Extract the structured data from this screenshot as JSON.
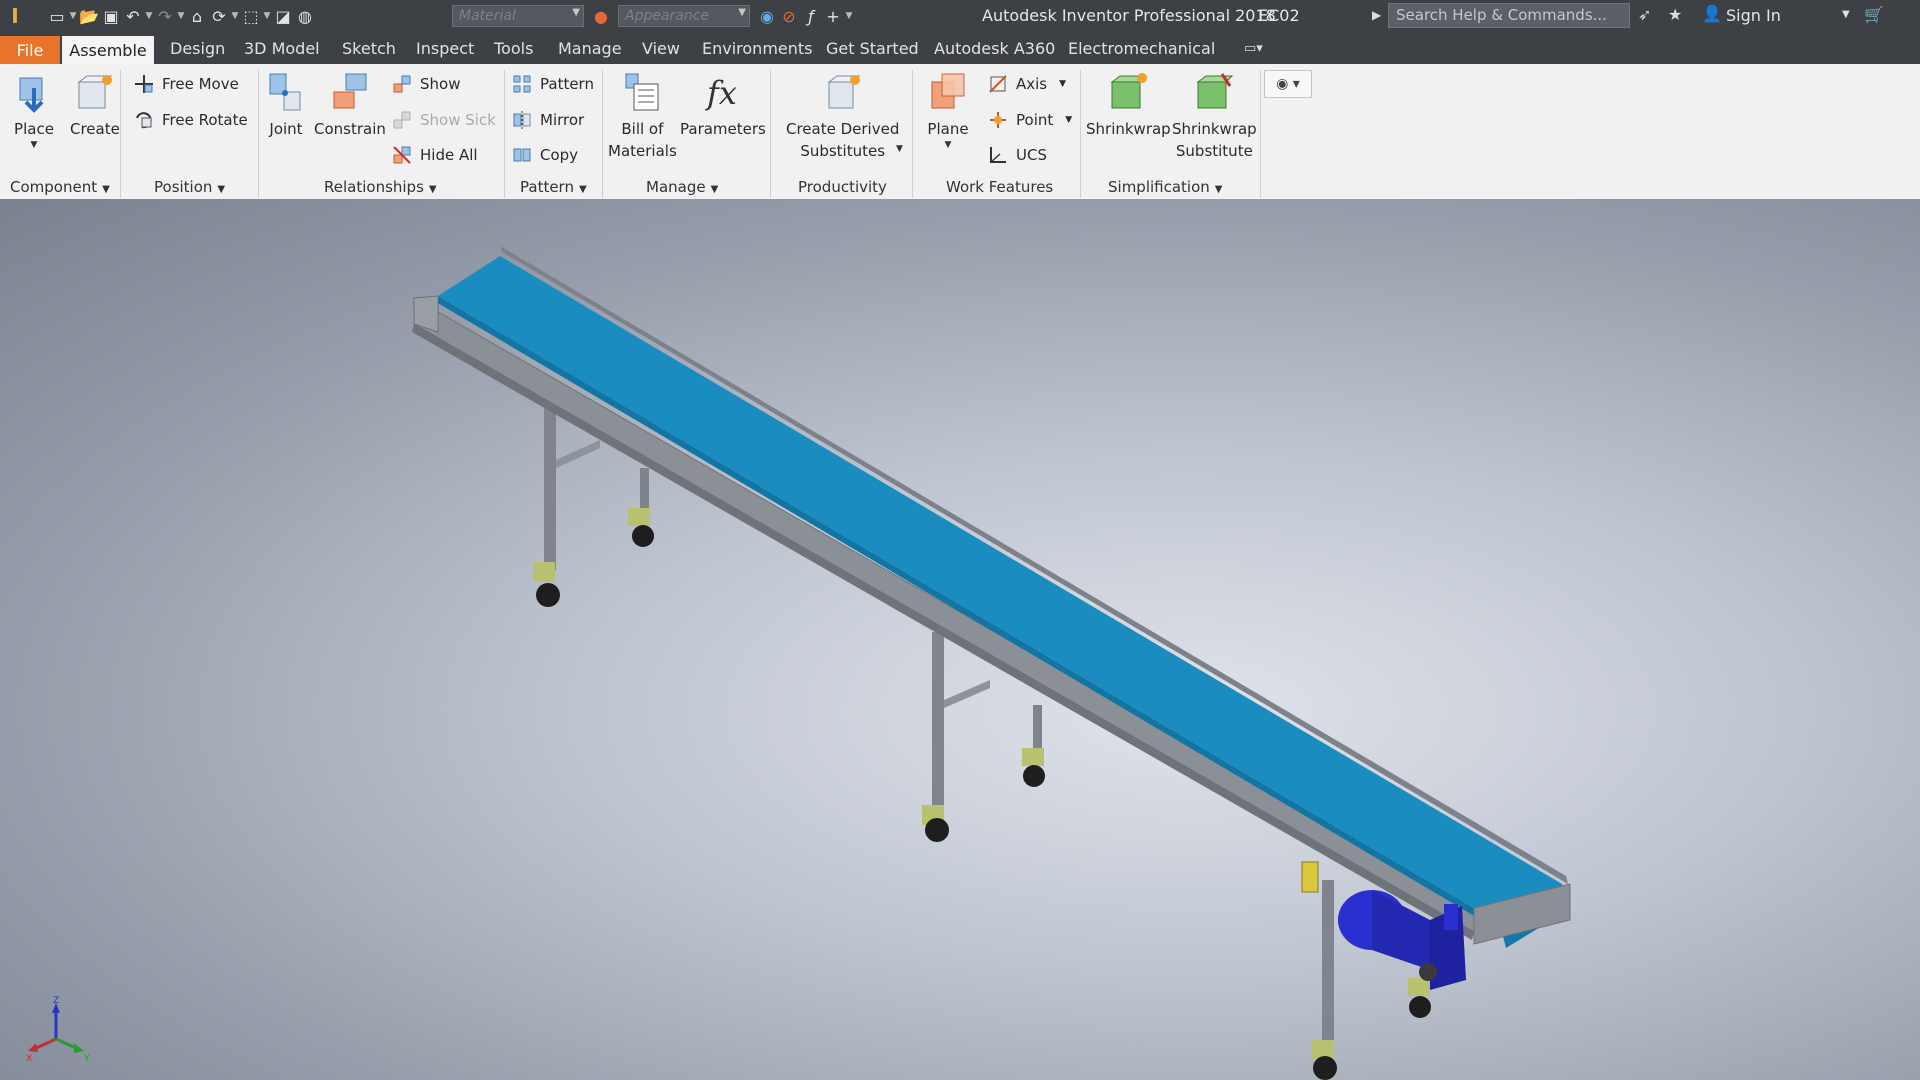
{
  "window": {
    "app_title": "Autodesk Inventor Professional 2018",
    "document_name": "EC02",
    "search_placeholder": "Search Help & Commands...",
    "sign_in_label": "Sign In",
    "material_placeholder": "Material",
    "appearance_placeholder": "Appearance"
  },
  "tabs": {
    "file": "File",
    "items": [
      "Assemble",
      "Design",
      "3D Model",
      "Sketch",
      "Inspect",
      "Tools",
      "Manage",
      "View",
      "Environments",
      "Get Started",
      "Autodesk A360",
      "Electromechanical"
    ]
  },
  "ribbon": {
    "component": {
      "label": "Component",
      "place": "Place",
      "create": "Create"
    },
    "position": {
      "label": "Position",
      "free_move": "Free Move",
      "free_rotate": "Free Rotate"
    },
    "relationships": {
      "label": "Relationships",
      "joint": "Joint",
      "constrain": "Constrain",
      "show": "Show",
      "show_sick": "Show Sick",
      "hide_all": "Hide All"
    },
    "pattern": {
      "label": "Pattern",
      "pattern": "Pattern",
      "mirror": "Mirror",
      "copy": "Copy"
    },
    "manage": {
      "label": "Manage",
      "bom_line1": "Bill of",
      "bom_line2": "Materials",
      "parameters": "Parameters"
    },
    "productivity": {
      "label": "Productivity",
      "line1": "Create Derived",
      "line2": "Substitutes"
    },
    "work_features": {
      "label": "Work Features",
      "plane": "Plane",
      "axis": "Axis",
      "point": "Point",
      "ucs": "UCS"
    },
    "simplification": {
      "label": "Simplification",
      "shrinkwrap": "Shrinkwrap",
      "sub_line1": "Shrinkwrap",
      "sub_line2": "Substitute"
    }
  },
  "triad": {
    "x": "X",
    "y": "Y",
    "z": "Z"
  },
  "colors": {
    "belt": "#1a8cc0",
    "frame": "#8c9097",
    "motor": "#2a2fd0",
    "file_tab": "#e8732b"
  }
}
